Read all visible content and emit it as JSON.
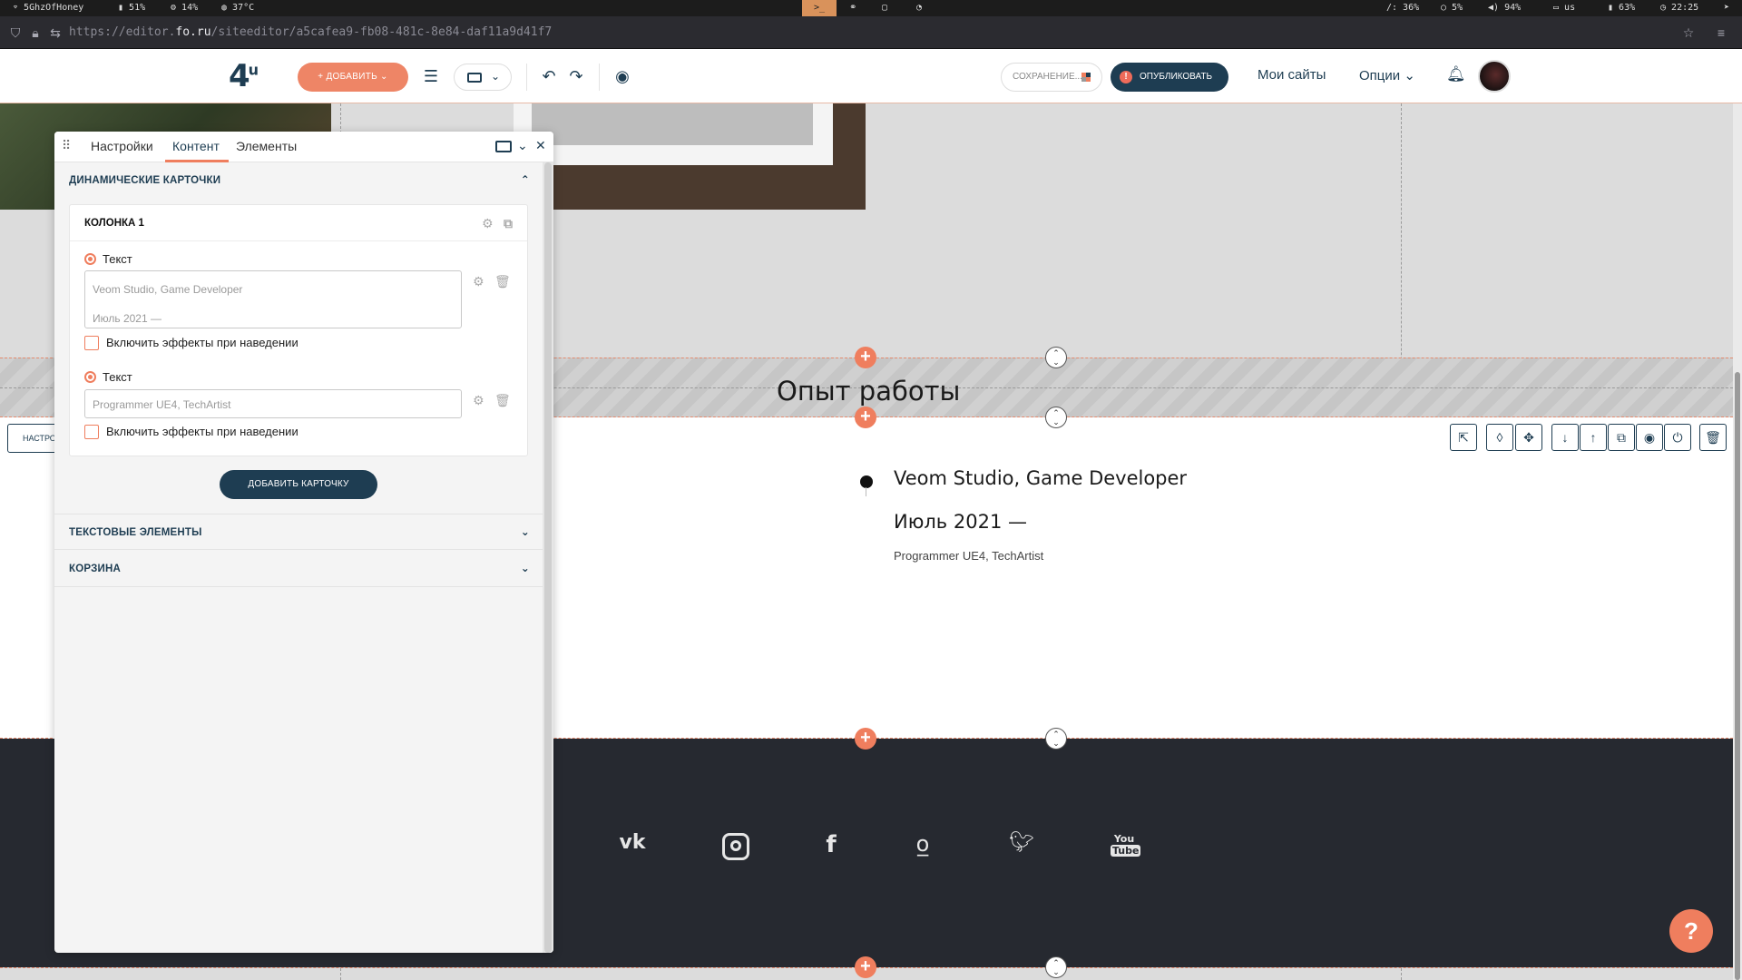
{
  "system_bar": {
    "wifi": "5GhzOfHoney",
    "battery_small": "51%",
    "cpu": "14%",
    "temp": "37°C",
    "terminal_glyph": ">_",
    "disk": "/: 36%",
    "load": "5%",
    "volume": "94%",
    "keyboard": "us",
    "battery": "63%",
    "clock": "22:25"
  },
  "browser": {
    "url_prefix": "https://editor.",
    "url_domain": "fo.ru",
    "url_path": "/siteeditor/a5cafea9-fb08-481c-8e84-daf11a9d41f7"
  },
  "toolbar": {
    "logo_main": "4",
    "logo_sup": "u",
    "add_label": "+ ДОБАВИТЬ ⌄",
    "saving_label": "СОХРАНЕНИЕ...",
    "publish_label": "ОПУБЛИКОВАТЬ",
    "my_sites": "Мои сайты",
    "options": "Опции"
  },
  "panel": {
    "tabs": [
      "Настройки",
      "Контент",
      "Элементы"
    ],
    "active_tab": "Контент",
    "section_dynamic_cards": "ДИНАМИЧЕСКИЕ КАРТОЧКИ",
    "card_title": "КОЛОНКА 1",
    "field1_label": "Текст",
    "field1_line1": "Veom Studio, Game Developer",
    "field1_line2": "Июль 2021 —",
    "hover_effects": "Включить эффекты при наведении",
    "field2_label": "Текст",
    "field2_value": "Programmer UE4, TechArtist",
    "add_card": "ДОБАВИТЬ КАРТОЧКУ",
    "section_text_elements": "ТЕКСТОВЫЕ ЭЛЕМЕНТЫ",
    "section_cart": "КОРЗИНА"
  },
  "canvas": {
    "settings_tab": "НАСТРОЙКИ",
    "section_title": "Опыт работы",
    "job_title": "Veom Studio, Game Developer",
    "job_date": "Июль 2021 —",
    "job_role": "Programmer UE4, TechArtist",
    "social_icons": [
      "vk-icon",
      "instagram-icon",
      "facebook-icon",
      "odnoklassniki-icon",
      "twitter-icon",
      "youtube-icon"
    ],
    "help": "?"
  },
  "colors": {
    "accent": "#ef7e5e",
    "brand_dark": "#1e3d52",
    "footer_bg": "#262930"
  }
}
